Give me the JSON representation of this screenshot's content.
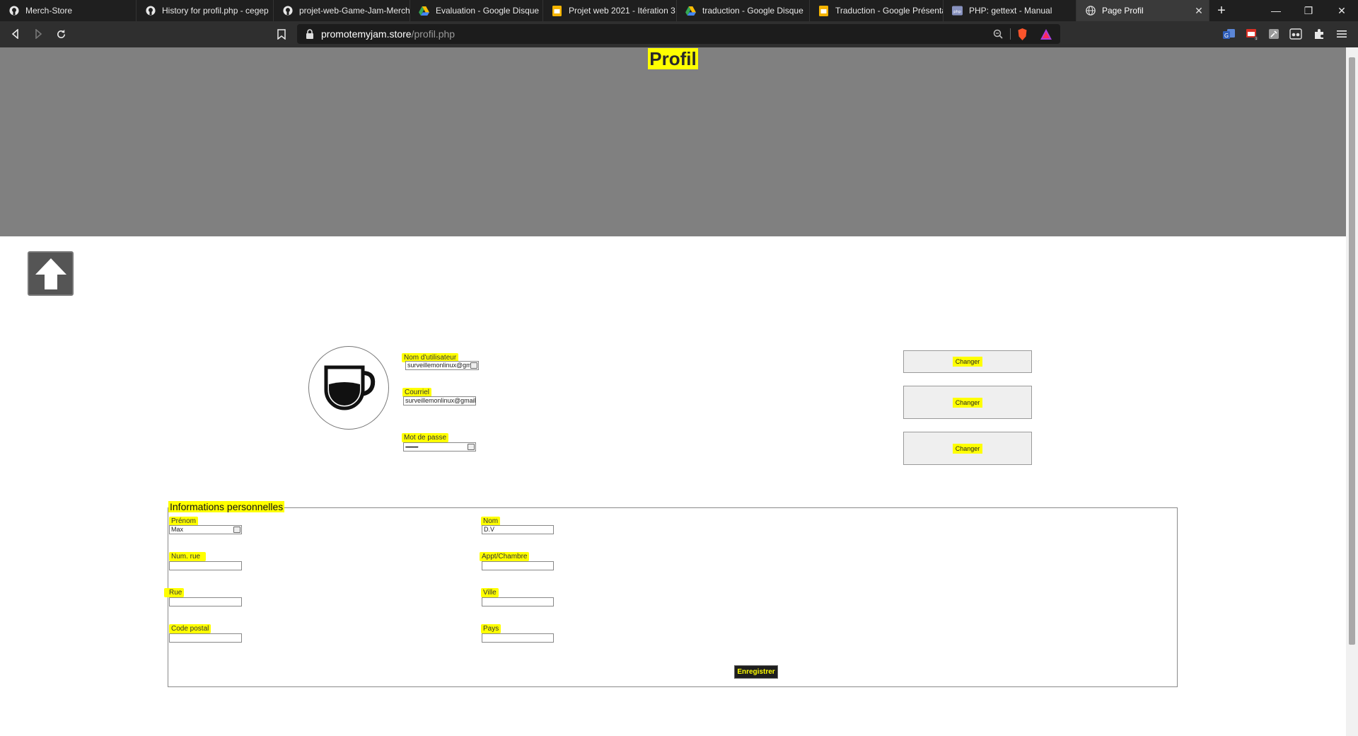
{
  "browser": {
    "tabs": [
      {
        "title": "Merch-Store",
        "icon": "github-icon"
      },
      {
        "title": "History for profil.php - cegep",
        "icon": "github-icon"
      },
      {
        "title": "projet-web-Game-Jam-Merch",
        "icon": "github-icon"
      },
      {
        "title": "Evaluation - Google Disque",
        "icon": "google-drive-icon"
      },
      {
        "title": "Projet web 2021 - Itération 3",
        "icon": "google-slides-icon"
      },
      {
        "title": "traduction - Google Disque",
        "icon": "google-drive-icon"
      },
      {
        "title": "Traduction - Google Présentation",
        "icon": "google-slides-icon"
      },
      {
        "title": "PHP: gettext - Manual",
        "icon": "php-icon"
      },
      {
        "title": "Page Profil",
        "icon": "globe-icon",
        "active": true
      }
    ],
    "new_tab": "+",
    "url_host": "promotemyjam.store",
    "url_path": "/profil.php"
  },
  "page": {
    "title": "Profil",
    "account": {
      "username_label": "Nom d'utilisateur",
      "username_value": "surveillemonlinux@gmail",
      "email_label": "Courriel",
      "email_value": "surveillemonlinux@gmail",
      "password_label": "Mot de passe",
      "password_value": "••••••••••••••••",
      "change_label": "Changer"
    },
    "personal": {
      "legend": "Informations personnelles",
      "prenom_label": "Prénom",
      "prenom_value": "Max",
      "nom_label": "Nom",
      "nom_value": "D.V",
      "num_rue_label": "Num. rue",
      "num_rue_value": "",
      "appt_label": "Appt/Chambre",
      "appt_value": "",
      "rue_label": "Rue",
      "rue_value": "",
      "ville_label": "Ville",
      "ville_value": "",
      "code_postal_label": "Code postal",
      "code_postal_value": "",
      "pays_label": "Pays",
      "pays_value": "",
      "save_label": "Enregistrer"
    }
  },
  "colors": {
    "highlight": "#ffff00",
    "header_bg": "#808080",
    "chrome_bg": "#1f1f1f"
  }
}
